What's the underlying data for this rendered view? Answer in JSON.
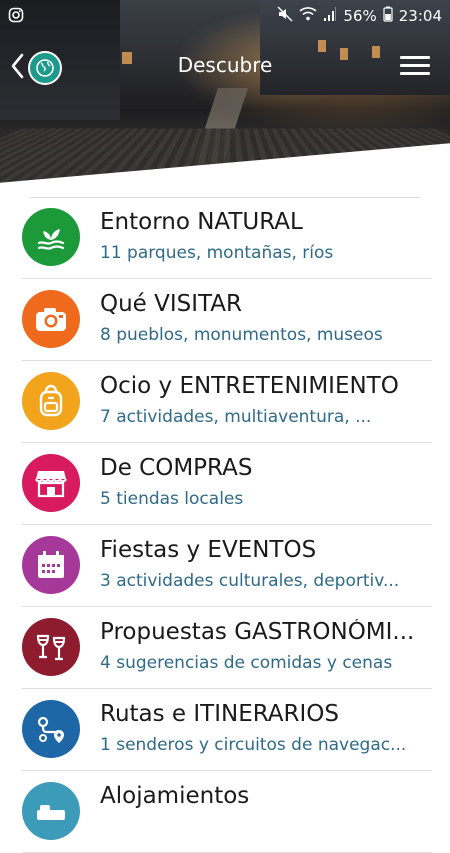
{
  "status_bar": {
    "battery_percent": "56%",
    "time": "23:04",
    "left_icon": "instagram-icon"
  },
  "header": {
    "title": "Descubre"
  },
  "items": [
    {
      "title": "Entorno NATURAL",
      "subtitle": "11 parques, montañas, ríos",
      "color": "#1c9a3a",
      "icon": "nature-icon"
    },
    {
      "title": "Qué VISITAR",
      "subtitle": "8 pueblos, monumentos, museos",
      "color": "#f06a1e",
      "icon": "camera-icon"
    },
    {
      "title": "Ocio y ENTRETENIMIENTO",
      "subtitle": "7 actividades, multiaventura, ...",
      "color": "#f2a51c",
      "icon": "backpack-icon"
    },
    {
      "title": "De COMPRAS",
      "subtitle": "5 tiendas locales",
      "color": "#d81b5e",
      "icon": "shop-icon"
    },
    {
      "title": "Fiestas y EVENTOS",
      "subtitle": "3 actividades culturales, deportiv...",
      "color": "#a6389a",
      "icon": "calendar-icon"
    },
    {
      "title": "Propuestas GASTRONÓMI...",
      "subtitle": "4 sugerencias de comidas y cenas",
      "color": "#8e1c2e",
      "icon": "wine-icon"
    },
    {
      "title": "Rutas e ITINERARIOS",
      "subtitle": "1 senderos y circuitos de navegac...",
      "color": "#1e67a6",
      "icon": "route-icon"
    },
    {
      "title": "Alojamientos",
      "subtitle": "",
      "color": "#3b9bb8",
      "icon": "lodging-icon"
    }
  ]
}
